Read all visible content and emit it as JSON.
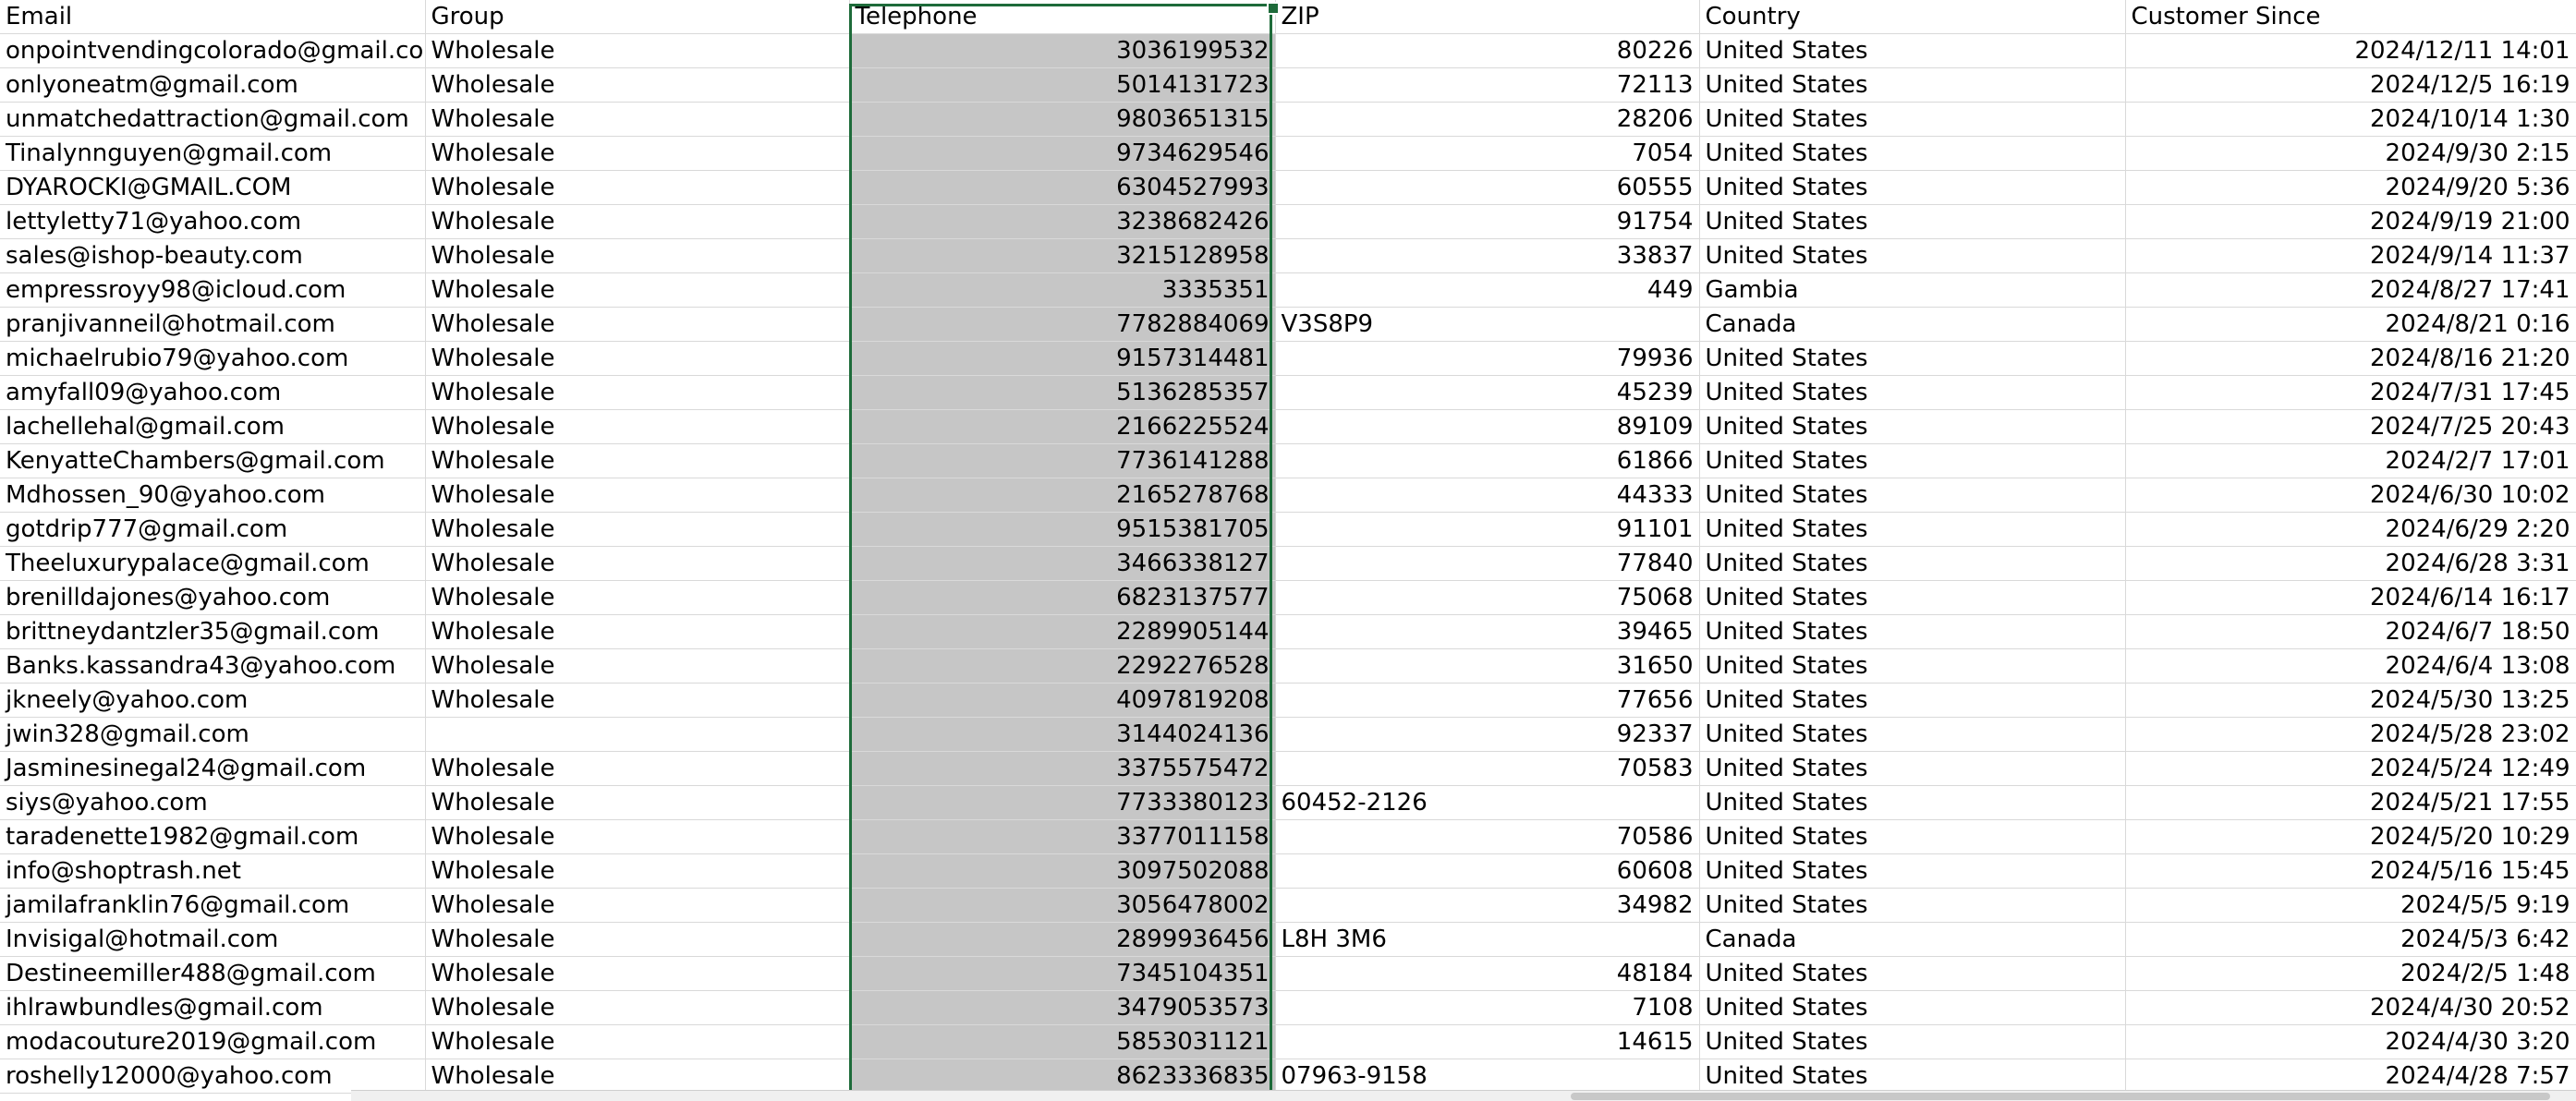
{
  "sheet": {
    "headers": [
      "Email",
      "Group",
      "Telephone",
      "ZIP",
      "Country",
      "Customer Since"
    ],
    "rows": [
      [
        "onpointvendingcolorado@gmail.com",
        "Wholesale",
        "3036199532",
        "80226",
        "United States",
        "2024/12/11 14:01"
      ],
      [
        "onlyoneatm@gmail.com",
        "Wholesale",
        "5014131723",
        "72113",
        "United States",
        "2024/12/5 16:19"
      ],
      [
        "unmatchedattraction@gmail.com",
        "Wholesale",
        "9803651315",
        "28206",
        "United States",
        "2024/10/14 1:30"
      ],
      [
        "Tinalynnguyen@gmail.com",
        "Wholesale",
        "9734629546",
        "7054",
        "United States",
        "2024/9/30 2:15"
      ],
      [
        "DYAROCKI@GMAIL.COM",
        "Wholesale",
        "6304527993",
        "60555",
        "United States",
        "2024/9/20 5:36"
      ],
      [
        "lettyletty71@yahoo.com",
        "Wholesale",
        "3238682426",
        "91754",
        "United States",
        "2024/9/19 21:00"
      ],
      [
        "sales@ishop-beauty.com",
        "Wholesale",
        "3215128958",
        "33837",
        "United States",
        "2024/9/14 11:37"
      ],
      [
        "empressroyy98@icloud.com",
        "Wholesale",
        "3335351",
        "449",
        "Gambia",
        "2024/8/27 17:41"
      ],
      [
        "pranjivanneil@hotmail.com",
        "Wholesale",
        "7782884069",
        "V3S8P9",
        "Canada",
        "2024/8/21 0:16"
      ],
      [
        "michaelrubio79@yahoo.com",
        "Wholesale",
        "9157314481",
        "79936",
        "United States",
        "2024/8/16 21:20"
      ],
      [
        "amyfall09@yahoo.com",
        "Wholesale",
        "5136285357",
        "45239",
        "United States",
        "2024/7/31 17:45"
      ],
      [
        "lachellehal@gmail.com",
        "Wholesale",
        "2166225524",
        "89109",
        "United States",
        "2024/7/25 20:43"
      ],
      [
        "KenyatteChambers@gmail.com",
        "Wholesale",
        "7736141288",
        "61866",
        "United States",
        "2024/2/7 17:01"
      ],
      [
        "Mdhossen_90@yahoo.com",
        "Wholesale",
        "2165278768",
        "44333",
        "United States",
        "2024/6/30 10:02"
      ],
      [
        "gotdrip777@gmail.com",
        "Wholesale",
        "9515381705",
        "91101",
        "United States",
        "2024/6/29 2:20"
      ],
      [
        "Theeluxurypalace@gmail.com",
        "Wholesale",
        "3466338127",
        "77840",
        "United States",
        "2024/6/28 3:31"
      ],
      [
        "brenilldajones@yahoo.com",
        "Wholesale",
        "6823137577",
        "75068",
        "United States",
        "2024/6/14 16:17"
      ],
      [
        "brittneydantzler35@gmail.com",
        "Wholesale",
        "2289905144",
        "39465",
        "United States",
        "2024/6/7 18:50"
      ],
      [
        "Banks.kassandra43@yahoo.com",
        "Wholesale",
        "2292276528",
        "31650",
        "United States",
        "2024/6/4 13:08"
      ],
      [
        "jkneely@yahoo.com",
        "Wholesale",
        "4097819208",
        "77656",
        "United States",
        "2024/5/30 13:25"
      ],
      [
        "jwin328@gmail.com",
        "",
        "3144024136",
        "92337",
        "United States",
        "2024/5/28 23:02"
      ],
      [
        "Jasminesinegal24@gmail.com",
        "Wholesale",
        "3375575472",
        "70583",
        "United States",
        "2024/5/24 12:49"
      ],
      [
        "siys@yahoo.com",
        "Wholesale",
        "7733380123",
        "60452-2126",
        "United States",
        "2024/5/21 17:55"
      ],
      [
        "taradenette1982@gmail.com",
        "Wholesale",
        "3377011158",
        "70586",
        "United States",
        "2024/5/20 10:29"
      ],
      [
        "info@shoptrash.net",
        "Wholesale",
        "3097502088",
        "60608",
        "United States",
        "2024/5/16 15:45"
      ],
      [
        "jamilafranklin76@gmail.com",
        "Wholesale",
        "3056478002",
        "34982",
        "United States",
        "2024/5/5 9:19"
      ],
      [
        "Invisigal@hotmail.com",
        "Wholesale",
        "2899936456",
        "L8H 3M6",
        "Canada",
        "2024/5/3 6:42"
      ],
      [
        "Destineemiller488@gmail.com",
        "Wholesale",
        "7345104351",
        "48184",
        "United States",
        "2024/2/5 1:48"
      ],
      [
        "ihlrawbundles@gmail.com",
        "Wholesale",
        "3479053573",
        "7108",
        "United States",
        "2024/4/30 20:52"
      ],
      [
        "modacouture2019@gmail.com",
        "Wholesale",
        "5853031121",
        "14615",
        "United States",
        "2024/4/30 3:20"
      ],
      [
        "roshelly12000@yahoo.com",
        "Wholesale",
        "8623336835",
        "07963-9158",
        "United States",
        "2024/4/28 7:57"
      ]
    ]
  },
  "colors": {
    "selection_border": "#1e6b3a",
    "selected_fill": "#c6c6c6",
    "gridline": "#d9d9d9"
  }
}
